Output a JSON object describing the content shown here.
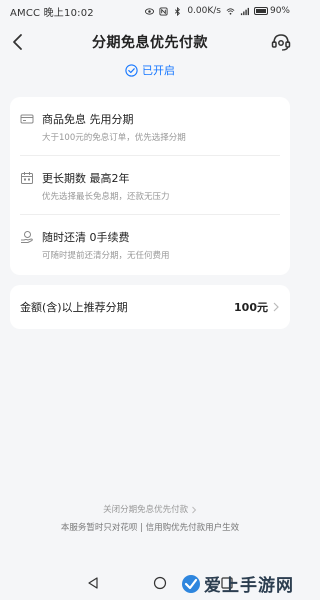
{
  "statusbar": {
    "carrier_time": "AMCC 晚上10:02",
    "network_speed": "0.00K/s",
    "battery": "90%"
  },
  "header": {
    "title": "分期免息优先付款"
  },
  "status": {
    "label": "已开启"
  },
  "benefits": [
    {
      "icon": "card-icon",
      "title": "商品免息 先用分期",
      "desc": "大于100元的免息订单，优先选择分期"
    },
    {
      "icon": "calendar-icon",
      "title": "更长期数 最高2年",
      "desc": "优先选择最长免息期，还款无压力"
    },
    {
      "icon": "hand-coin-icon",
      "title": "随时还清 0手续费",
      "desc": "可随时提前还清分期，无任何费用"
    }
  ],
  "amount": {
    "label": "金额(含)以上推荐分期",
    "value": "100元"
  },
  "footer": {
    "close_link": "关闭分期免息优先付款",
    "notice": "本服务暂时只对花呗 | 信用购优先付款用户生效"
  },
  "watermark": {
    "text": "爱上手游网"
  },
  "colors": {
    "accent": "#1677ff",
    "background": "#f5f6f8"
  }
}
